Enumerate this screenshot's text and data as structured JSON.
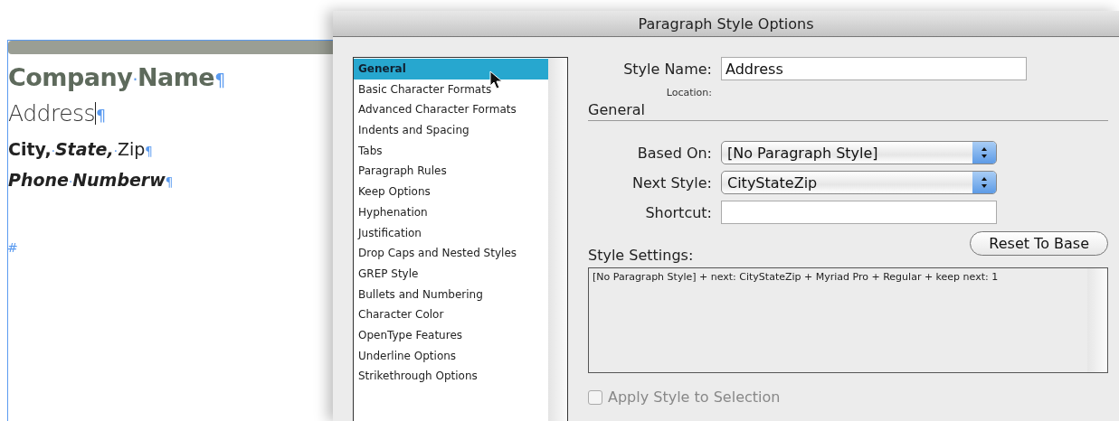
{
  "document": {
    "lines": [
      {
        "kind": "heading",
        "runs": [
          {
            "text": "Company",
            "kind": "text"
          },
          {
            "text": "·",
            "kind": "mark"
          },
          {
            "text": "Name",
            "kind": "text"
          },
          {
            "text": "¶",
            "kind": "mark"
          }
        ]
      },
      {
        "kind": "body",
        "cursor": true,
        "runs": [
          {
            "text": "Address",
            "kind": "text"
          },
          {
            "text": "¶",
            "kind": "mark"
          }
        ]
      },
      {
        "kind": "city",
        "runs": [
          {
            "text": "City,",
            "kind": "bold"
          },
          {
            "text": "·",
            "kind": "mark"
          },
          {
            "text": "State,",
            "kind": "bolditalic"
          },
          {
            "text": "·",
            "kind": "mark"
          },
          {
            "text": "Zip",
            "kind": "text"
          },
          {
            "text": "¶",
            "kind": "mark"
          }
        ]
      },
      {
        "kind": "phone",
        "runs": [
          {
            "text": "Phone",
            "kind": "text"
          },
          {
            "text": "·",
            "kind": "mark"
          },
          {
            "text": "Numberw",
            "kind": "text"
          },
          {
            "text": "¶",
            "kind": "mark"
          }
        ]
      }
    ],
    "end_mark": "#"
  },
  "dialog": {
    "title": "Paragraph Style Options",
    "categories": [
      {
        "label": "General",
        "selected": true
      },
      {
        "label": "Basic Character Formats",
        "selected": false
      },
      {
        "label": "Advanced Character Formats",
        "selected": false
      },
      {
        "label": "Indents and Spacing",
        "selected": false
      },
      {
        "label": "Tabs",
        "selected": false
      },
      {
        "label": "Paragraph Rules",
        "selected": false
      },
      {
        "label": "Keep Options",
        "selected": false
      },
      {
        "label": "Hyphenation",
        "selected": false
      },
      {
        "label": "Justification",
        "selected": false
      },
      {
        "label": "Drop Caps and Nested Styles",
        "selected": false
      },
      {
        "label": "GREP Style",
        "selected": false
      },
      {
        "label": "Bullets and Numbering",
        "selected": false
      },
      {
        "label": "Character Color",
        "selected": false
      },
      {
        "label": "OpenType Features",
        "selected": false
      },
      {
        "label": "Underline Options",
        "selected": false
      },
      {
        "label": "Strikethrough Options",
        "selected": false
      }
    ],
    "style_name": {
      "label": "Style Name:",
      "value": "Address"
    },
    "location_label": "Location:",
    "section_title": "General",
    "based_on": {
      "label": "Based On:",
      "value": "[No Paragraph Style]"
    },
    "next_style": {
      "label": "Next Style:",
      "value": "CityStateZip"
    },
    "shortcut": {
      "label": "Shortcut:"
    },
    "reset_button": "Reset To Base",
    "style_settings": {
      "label": "Style Settings:",
      "text": "[No Paragraph Style] + next: CityStateZip + Myriad Pro + Regular + keep next:  1"
    },
    "apply_checkbox": {
      "label": "Apply Style to Selection",
      "checked": false,
      "disabled": true
    }
  }
}
